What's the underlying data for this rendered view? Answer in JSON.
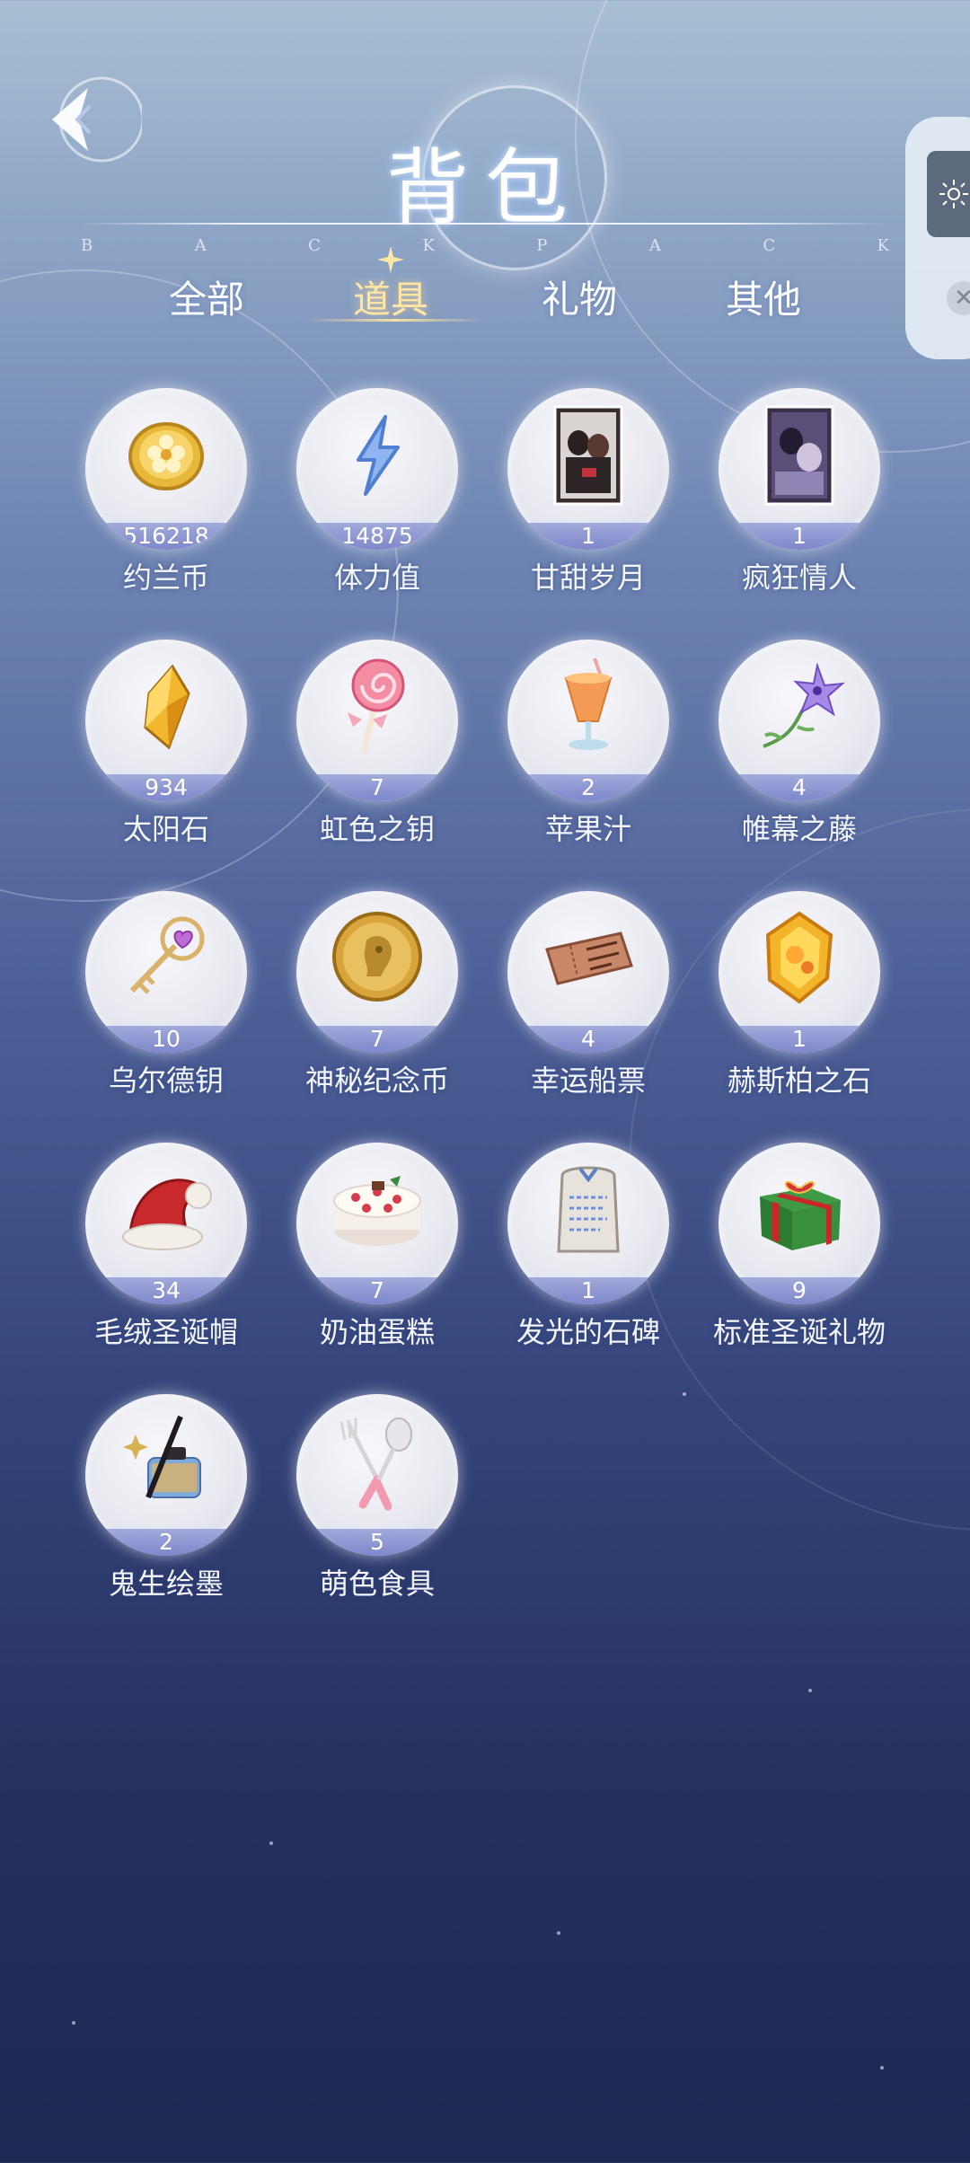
{
  "header": {
    "title": "背包",
    "subtitle_letters": [
      "B",
      "A",
      "C",
      "K",
      "P",
      "A",
      "C",
      "K"
    ],
    "back_icon": "back-arrow-icon"
  },
  "tabs": [
    {
      "label": "全部",
      "active": false
    },
    {
      "label": "道具",
      "active": true
    },
    {
      "label": "礼物",
      "active": false
    },
    {
      "label": "其他",
      "active": false
    }
  ],
  "items": [
    {
      "name": "约兰币",
      "count": "516218",
      "icon": "gold-coin-icon"
    },
    {
      "name": "体力值",
      "count": "14875",
      "icon": "lightning-icon"
    },
    {
      "name": "甘甜岁月",
      "count": "1",
      "icon": "card-art-icon"
    },
    {
      "name": "疯狂情人",
      "count": "1",
      "icon": "card-art-icon"
    },
    {
      "name": "太阳石",
      "count": "934",
      "icon": "sun-crystal-icon"
    },
    {
      "name": "虹色之钥",
      "count": "7",
      "icon": "lollipop-icon"
    },
    {
      "name": "苹果汁",
      "count": "2",
      "icon": "juice-glass-icon"
    },
    {
      "name": "帷幕之藤",
      "count": "4",
      "icon": "flower-vine-icon"
    },
    {
      "name": "乌尔德钥",
      "count": "10",
      "icon": "heart-key-icon"
    },
    {
      "name": "神秘纪念币",
      "count": "7",
      "icon": "commemorative-coin-icon"
    },
    {
      "name": "幸运船票",
      "count": "4",
      "icon": "ticket-icon"
    },
    {
      "name": "赫斯柏之石",
      "count": "1",
      "icon": "amber-gem-icon"
    },
    {
      "name": "毛绒圣诞帽",
      "count": "34",
      "icon": "santa-hat-icon"
    },
    {
      "name": "奶油蛋糕",
      "count": "7",
      "icon": "cake-icon"
    },
    {
      "name": "发光的石碑",
      "count": "1",
      "icon": "stone-tablet-icon"
    },
    {
      "name": "标准圣诞礼物",
      "count": "9",
      "icon": "gift-box-icon"
    },
    {
      "name": "鬼生绘墨",
      "count": "2",
      "icon": "ink-bottle-icon"
    },
    {
      "name": "萌色食具",
      "count": "5",
      "icon": "cutlery-icon"
    }
  ]
}
